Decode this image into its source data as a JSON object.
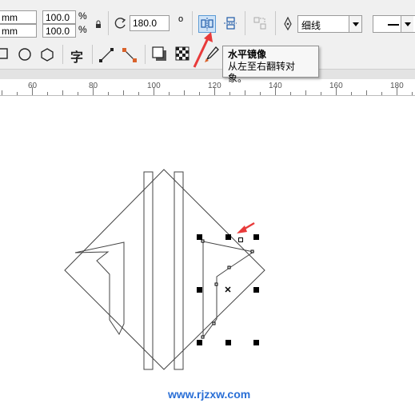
{
  "property_bar": {
    "width_unit": "mm",
    "height_unit": "mm",
    "scale_x": "100.0",
    "scale_y": "100.0",
    "percent": "%",
    "rotation": "180.0",
    "degree_symbol": "o",
    "outline_width": "细线"
  },
  "tooltip": {
    "title": "水平镜像",
    "description": "从左至右翻转对象。"
  },
  "toolbox": {
    "text_tool_glyph": "字"
  },
  "ruler": {
    "labels": [
      "60",
      "80",
      "100",
      "120",
      "140",
      "160",
      "180"
    ]
  },
  "watermark": "www.rjzxw.com",
  "colors": {
    "annotation_arrow": "#e83a3a",
    "highlight_button": "#cfe3f7",
    "watermark": "#2a6fd6"
  }
}
